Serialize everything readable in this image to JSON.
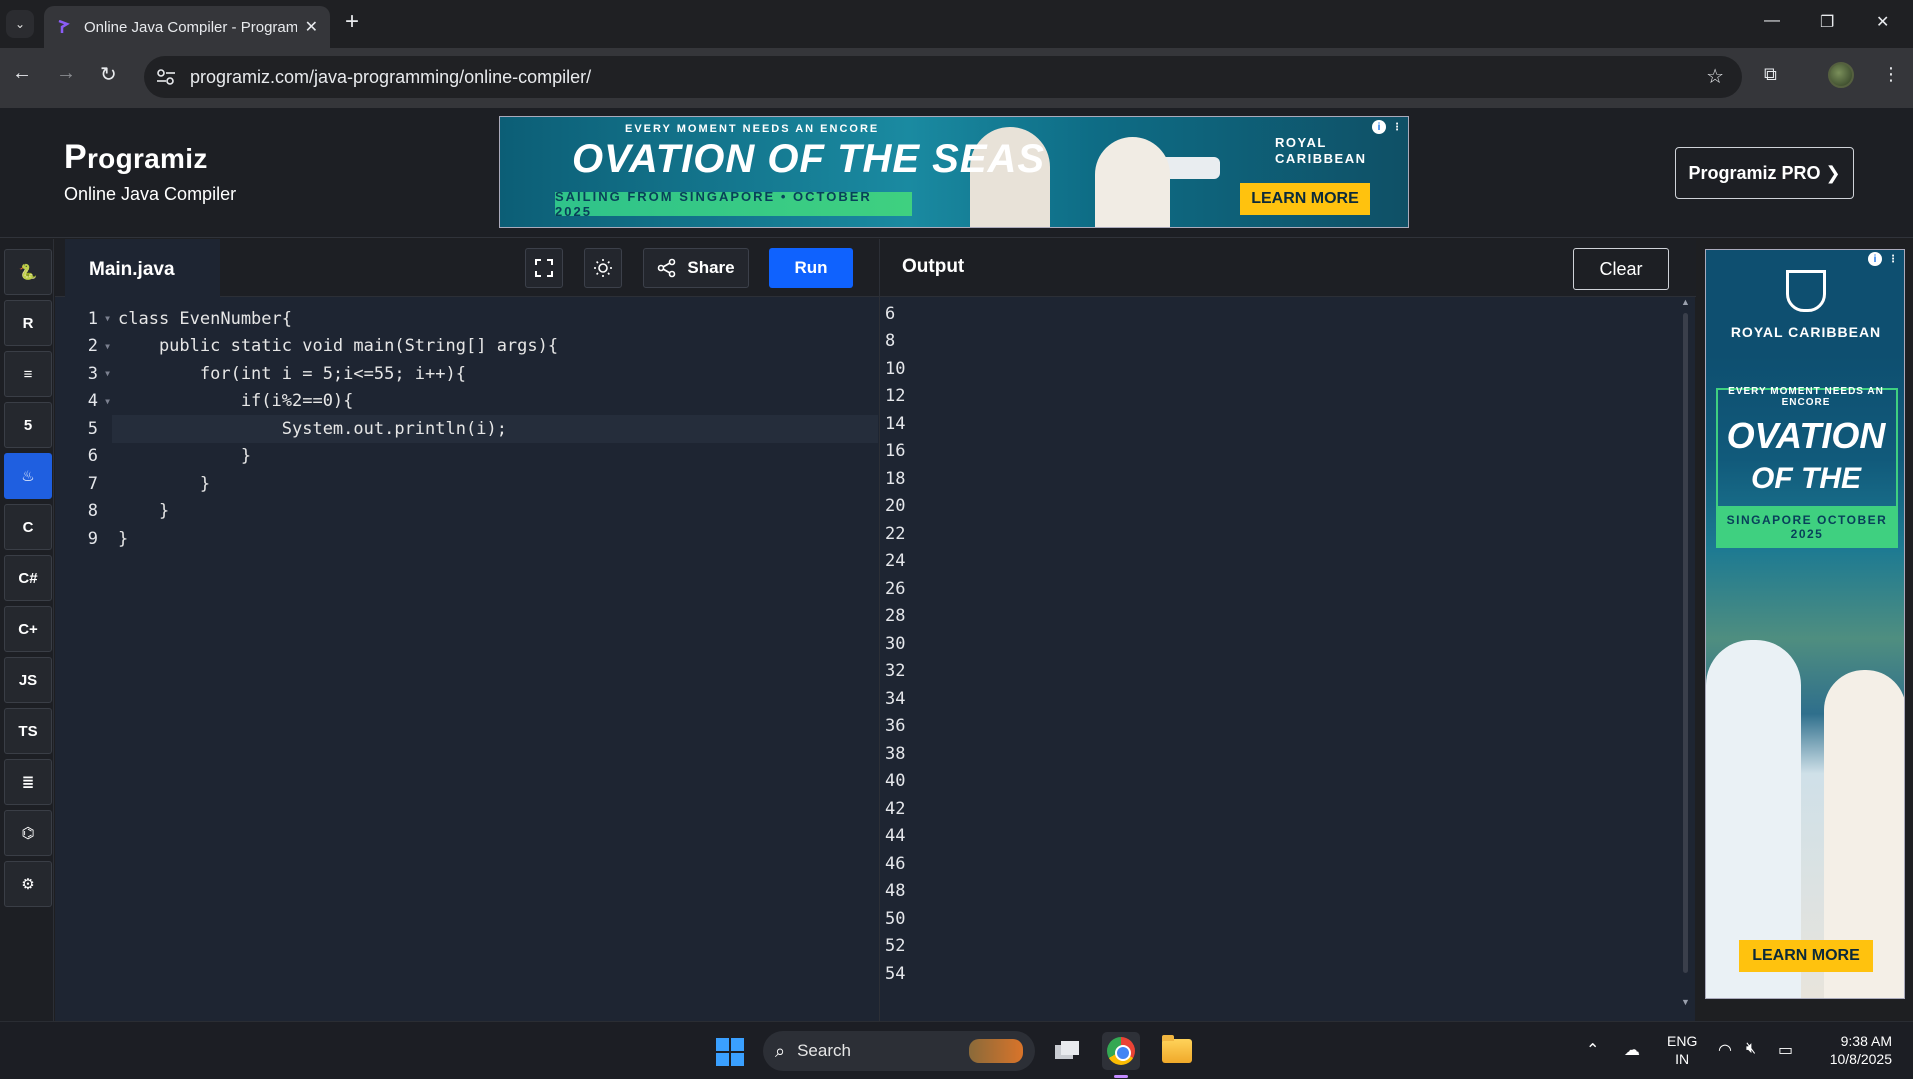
{
  "browser": {
    "tab_title": "Online Java Compiler - Programiz",
    "url": "programiz.com/java-programming/online-compiler/"
  },
  "header": {
    "logo_text": "rogramiz",
    "logo_letter": "P",
    "subtitle": "Online Java Compiler",
    "pro_button": "Programiz PRO ❯"
  },
  "ad_top": {
    "tagline": "EVERY MOMENT NEEDS AN ENCORE",
    "headline": "OVATION OF THE SEAS",
    "band": "SAILING FROM SINGAPORE • OCTOBER 2025",
    "brand_line1": "ROYAL",
    "brand_line2": "CARIBBEAN",
    "cta": "LEARN MORE"
  },
  "ad_side": {
    "brand": "ROYAL CARIBBEAN",
    "tagline": "EVERY MOMENT NEEDS AN ENCORE",
    "headline_1": "OVATION",
    "headline_2": "OF THE SEAS",
    "band": "SINGAPORE OCTOBER 2025",
    "cta": "LEARN MORE"
  },
  "languages": [
    {
      "icon": "python-icon",
      "glyph": "🐍",
      "active": false
    },
    {
      "icon": "r-lang-icon",
      "glyph": "R",
      "active": false
    },
    {
      "icon": "sql-icon",
      "glyph": "≡",
      "active": false
    },
    {
      "icon": "html5-icon",
      "glyph": "5",
      "active": false
    },
    {
      "icon": "java-icon",
      "glyph": "♨",
      "active": true
    },
    {
      "icon": "c-lang-icon",
      "glyph": "C",
      "active": false
    },
    {
      "icon": "csharp-icon",
      "glyph": "C#",
      "active": false
    },
    {
      "icon": "cpp-icon",
      "glyph": "C+",
      "active": false
    },
    {
      "icon": "javascript-icon",
      "glyph": "JS",
      "active": false
    },
    {
      "icon": "typescript-icon",
      "glyph": "TS",
      "active": false
    },
    {
      "icon": "go-icon",
      "glyph": "≣",
      "active": false
    },
    {
      "icon": "swift-icon",
      "glyph": "⌬",
      "active": false
    },
    {
      "icon": "rust-icon",
      "glyph": "⚙",
      "active": false
    }
  ],
  "editor": {
    "file_name": "Main.java",
    "share_label": "Share",
    "run_label": "Run",
    "active_line": 5,
    "code_lines": [
      "class EvenNumber{",
      "    public static void main(String[] args){",
      "        for(int i = 5;i<=55; i++){",
      "            if(i%2==0){",
      "                System.out.println(i);",
      "            }",
      "        }",
      "    }",
      "}"
    ]
  },
  "output": {
    "title": "Output",
    "clear_label": "Clear",
    "lines": [
      "6",
      "8",
      "10",
      "12",
      "14",
      "16",
      "18",
      "20",
      "22",
      "24",
      "26",
      "28",
      "30",
      "32",
      "34",
      "36",
      "38",
      "40",
      "42",
      "44",
      "46",
      "48",
      "50",
      "52",
      "54"
    ]
  },
  "taskbar": {
    "search_label": "Search",
    "lang_line1": "ENG",
    "lang_line2": "IN",
    "time": "9:38 AM",
    "date": "10/8/2025"
  }
}
